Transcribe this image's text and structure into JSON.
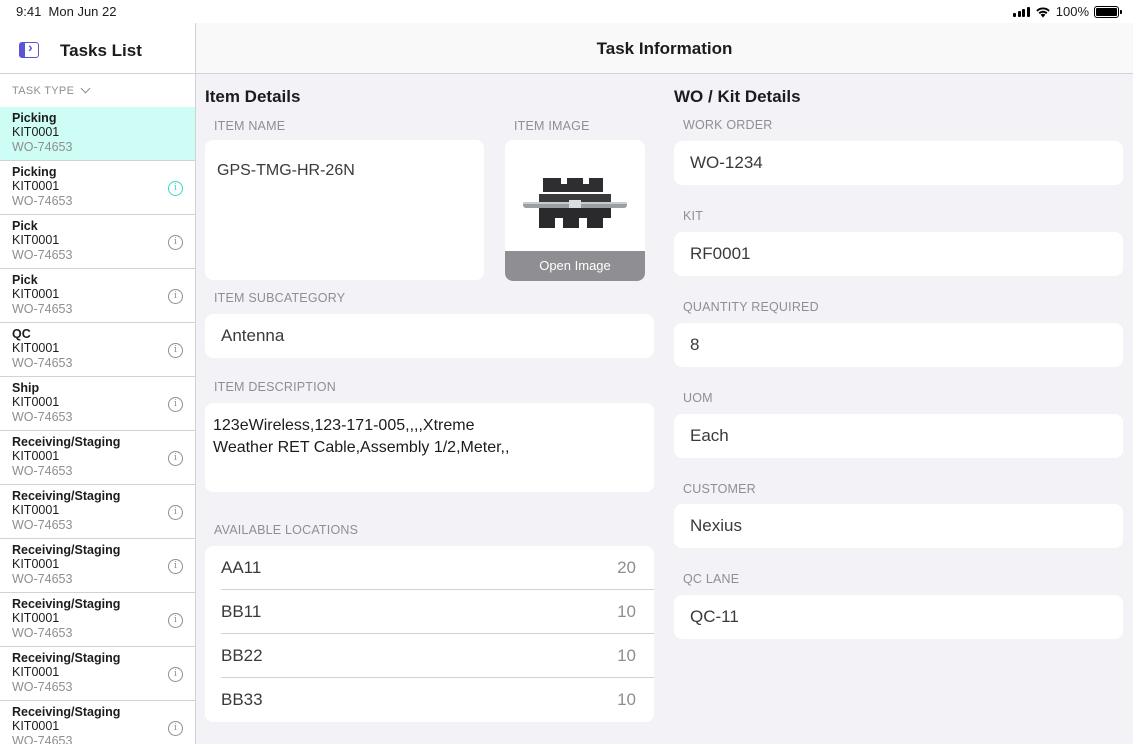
{
  "status_bar": {
    "time": "9:41",
    "date": "Mon Jun 22",
    "battery": "100%"
  },
  "sidebar": {
    "title": "Tasks List",
    "filter_label": "TASK TYPE",
    "tasks": [
      {
        "type": "Picking",
        "kit": "KIT0001",
        "wo": "WO-74653",
        "selected": true
      },
      {
        "type": "Picking",
        "kit": "KIT0001",
        "wo": "WO-74653"
      },
      {
        "type": "Pick",
        "kit": "KIT0001",
        "wo": "WO-74653"
      },
      {
        "type": "Pick",
        "kit": "KIT0001",
        "wo": "WO-74653"
      },
      {
        "type": "QC",
        "kit": "KIT0001",
        "wo": "WO-74653"
      },
      {
        "type": "Ship",
        "kit": "KIT0001",
        "wo": "WO-74653"
      },
      {
        "type": "Receiving/Staging",
        "kit": "KIT0001",
        "wo": "WO-74653"
      },
      {
        "type": "Receiving/Staging",
        "kit": "KIT0001",
        "wo": "WO-74653"
      },
      {
        "type": "Receiving/Staging",
        "kit": "KIT0001",
        "wo": "WO-74653"
      },
      {
        "type": "Receiving/Staging",
        "kit": "KIT0001",
        "wo": "WO-74653"
      },
      {
        "type": "Receiving/Staging",
        "kit": "KIT0001",
        "wo": "WO-74653"
      },
      {
        "type": "Receiving/Staging",
        "kit": "KIT0001",
        "wo": "WO-74653"
      }
    ]
  },
  "header": {
    "title": "Task Information"
  },
  "item_details": {
    "title": "Item Details",
    "name_label": "ITEM NAME",
    "name_value": "GPS-TMG-HR-26N",
    "image_label": "ITEM IMAGE",
    "open_image": "Open Image",
    "subcategory_label": "ITEM SUBCATEGORY",
    "subcategory_value": "Antenna",
    "description_label": "ITEM DESCRIPTION",
    "description_value": "123eWireless,123-171-005,,,,Xtreme Weather RET Cable,Assembly 1/2,Meter,,",
    "locations_label": "AVAILABLE LOCATIONS",
    "locations": [
      {
        "name": "AA11",
        "qty": "20"
      },
      {
        "name": "BB11",
        "qty": "10"
      },
      {
        "name": "BB22",
        "qty": "10"
      },
      {
        "name": "BB33",
        "qty": "10"
      }
    ]
  },
  "wo_details": {
    "title": "WO / Kit Details",
    "work_order_label": "WORK ORDER",
    "work_order_value": "WO-1234",
    "kit_label": "KIT",
    "kit_value": "RF0001",
    "qty_label": "QUANTITY REQUIRED",
    "qty_value": "8",
    "uom_label": "UOM",
    "uom_value": "Each",
    "customer_label": "CUSTOMER",
    "customer_value": "Nexius",
    "qc_lane_label": "QC LANE",
    "qc_lane_value": "QC-11"
  },
  "colors": {
    "accent": "#5856d6",
    "selected_row": "#cdfdf5",
    "info_active": "#3cd6c8"
  }
}
